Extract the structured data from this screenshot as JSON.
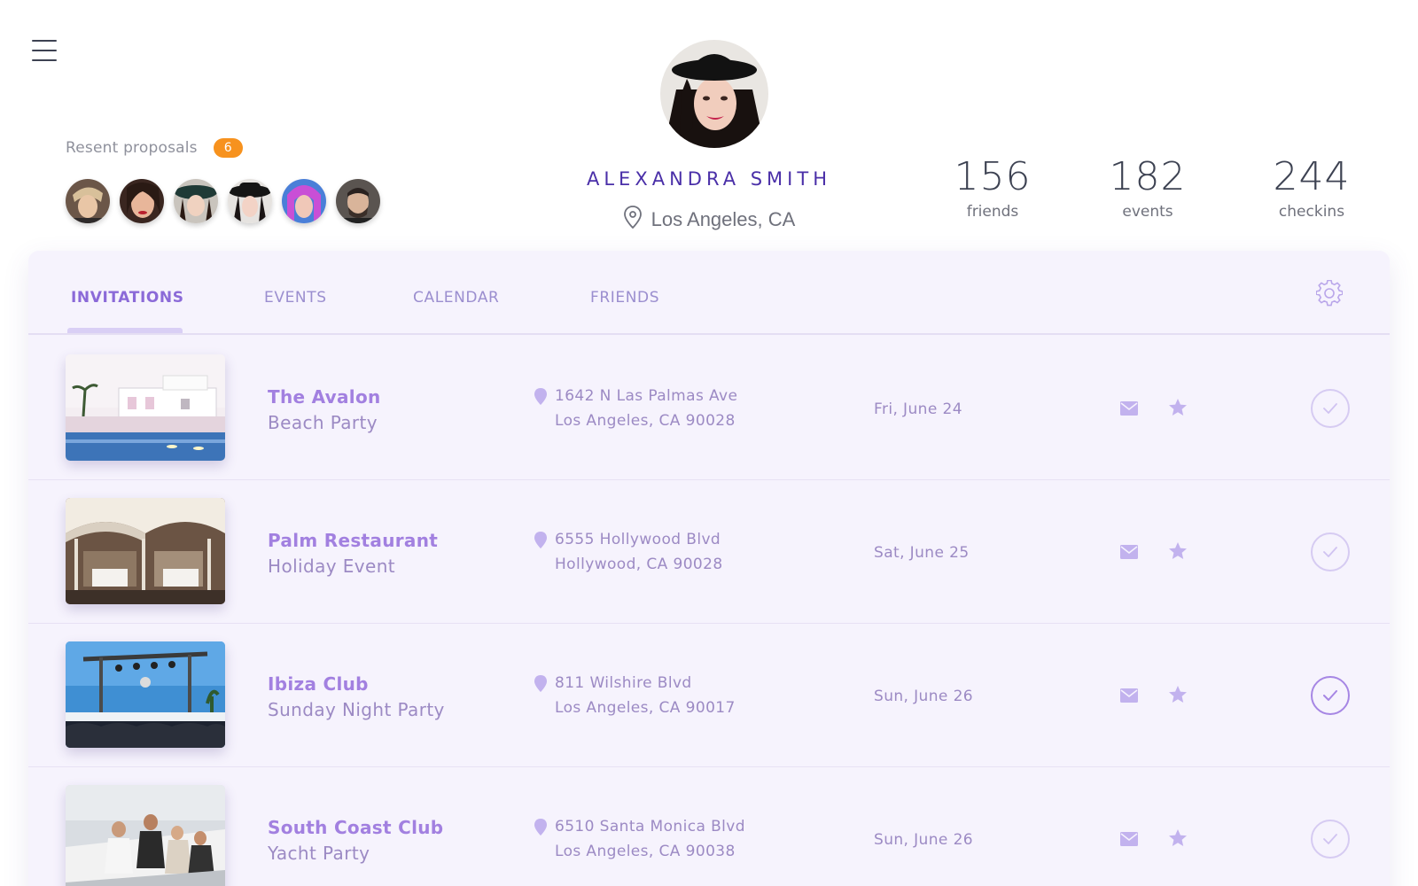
{
  "proposals": {
    "title": "Resent proposals",
    "count": "6",
    "avatars": [
      "proposal-avatar-1",
      "proposal-avatar-2",
      "proposal-avatar-3",
      "proposal-avatar-4",
      "proposal-avatar-5",
      "proposal-avatar-6"
    ]
  },
  "profile": {
    "name": "ALEXANDRA SMITH",
    "location": "Los Angeles, CA"
  },
  "stats": [
    {
      "value": "156",
      "label": "friends"
    },
    {
      "value": "182",
      "label": "events"
    },
    {
      "value": "244",
      "label": "checkins"
    }
  ],
  "tabs": [
    {
      "label": "INVITATIONS",
      "active": true
    },
    {
      "label": "EVENTS",
      "active": false
    },
    {
      "label": "CALENDAR",
      "active": false
    },
    {
      "label": "FRIENDS",
      "active": false
    }
  ],
  "icons": [
    "menu-icon",
    "location-pin-icon",
    "gear-icon",
    "map-marker-icon",
    "mail-icon",
    "star-icon",
    "check-icon"
  ],
  "colors": {
    "accent": "#a280e0",
    "accent_dark": "#4a2fa8",
    "badge": "#f7921e",
    "card_bg": "#f6f3fd",
    "icon_muted": "#c2b2ee"
  },
  "invitations": [
    {
      "name": "The Avalon",
      "subtitle": "Beach Party",
      "address1": "1642 N Las Palmas Ave",
      "address2": "Los Angeles, CA 90028",
      "date": "Fri, June 24",
      "accepted": false
    },
    {
      "name": "Palm Restaurant",
      "subtitle": "Holiday Event",
      "address1": "6555 Hollywood Blvd",
      "address2": "Hollywood, CA 90028",
      "date": "Sat, June 25",
      "accepted": false
    },
    {
      "name": "Ibiza Club",
      "subtitle": "Sunday Night Party",
      "address1": "811 Wilshire Blvd",
      "address2": "Los Angeles, CA 90017",
      "date": "Sun, June 26",
      "accepted": true
    },
    {
      "name": "South Coast Club",
      "subtitle": "Yacht Party",
      "address1": "6510 Santa Monica Blvd",
      "address2": "Los Angeles, CA 90038",
      "date": "Sun, June 26",
      "accepted": false
    }
  ]
}
